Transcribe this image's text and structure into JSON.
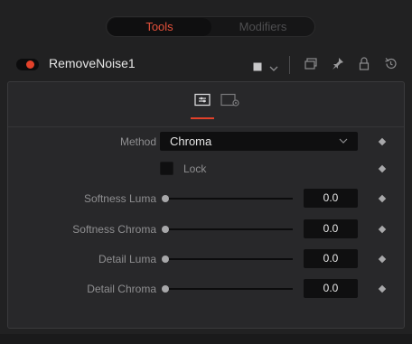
{
  "tabs": {
    "tools": "Tools",
    "modifiers": "Modifiers",
    "active": "Tools"
  },
  "tool": {
    "name": "RemoveNoise1",
    "enabled": true
  },
  "header_icons": [
    "color-swatch-icon",
    "chevron-down-icon",
    "version-icon",
    "pin-icon",
    "lock-icon",
    "reset-icon"
  ],
  "panel_tabs": [
    {
      "name": "controls-tab-icon",
      "active": true
    },
    {
      "name": "settings-tab-icon",
      "active": false
    }
  ],
  "controls": {
    "method": {
      "label": "Method",
      "value": "Chroma"
    },
    "lock": {
      "label": "Lock",
      "checked": false
    },
    "softness_luma": {
      "label": "Softness Luma",
      "value": "0.0",
      "fraction": 0
    },
    "softness_chroma": {
      "label": "Softness Chroma",
      "value": "0.0",
      "fraction": 0
    },
    "detail_luma": {
      "label": "Detail Luma",
      "value": "0.0",
      "fraction": 0
    },
    "detail_chroma": {
      "label": "Detail Chroma",
      "value": "0.0",
      "fraction": 0
    }
  },
  "colors": {
    "accent": "#e2412a",
    "tab_active_text": "#e2503a"
  }
}
